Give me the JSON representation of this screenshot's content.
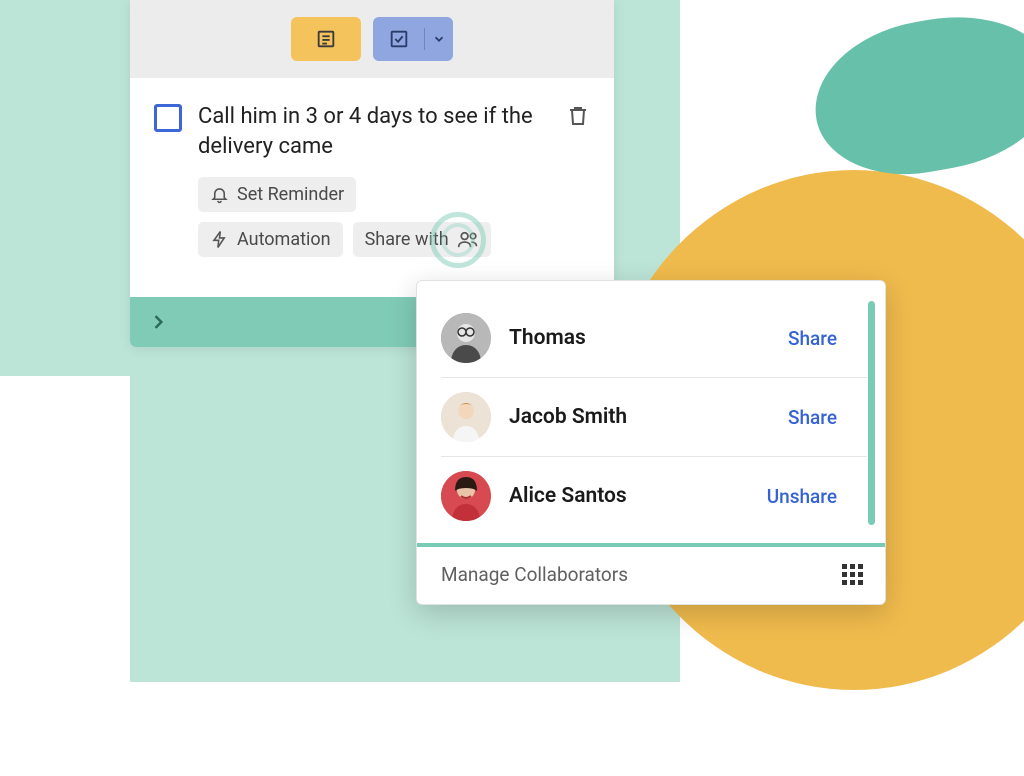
{
  "task": {
    "text": "Call him in 3 or 4 days to see if the delivery came",
    "reminder_label": "Set Reminder",
    "automation_label": "Automation",
    "share_with_label": "Share with"
  },
  "popup": {
    "people": [
      {
        "name": "Thomas",
        "action": "Share"
      },
      {
        "name": "Jacob Smith",
        "action": "Share"
      },
      {
        "name": "Alice Santos",
        "action": "Unshare"
      }
    ],
    "manage_label": "Manage Collaborators"
  },
  "colors": {
    "teal_light": "#bce4d7",
    "teal_mid": "#80cbb6",
    "teal_dark": "#67c0a9",
    "yellow": "#f0bb4d",
    "blue": "#90a6e0",
    "link": "#3563d4",
    "checkbox": "#3b68d6"
  }
}
